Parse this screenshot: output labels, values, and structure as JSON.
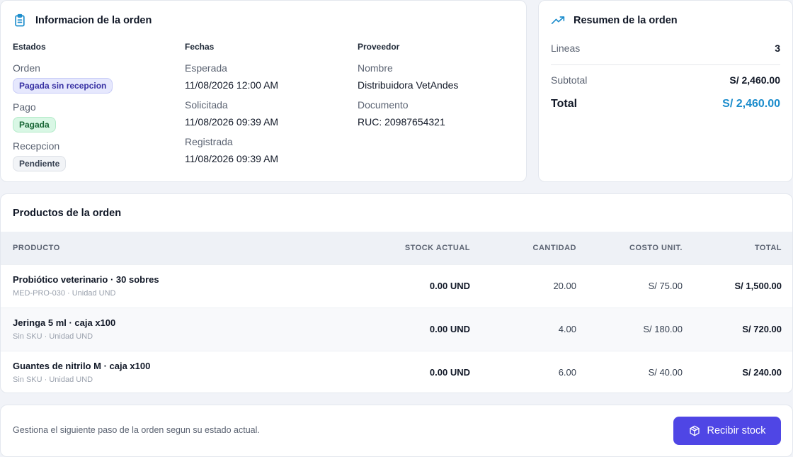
{
  "info": {
    "title": "Informacion de la orden",
    "icon": "clipboard-icon",
    "estados": {
      "heading": "Estados",
      "orden_label": "Orden",
      "orden_badge": "Pagada sin recepcion",
      "pago_label": "Pago",
      "pago_badge": "Pagada",
      "recepcion_label": "Recepcion",
      "recepcion_badge": "Pendiente"
    },
    "fechas": {
      "heading": "Fechas",
      "esperada_label": "Esperada",
      "esperada_value": "11/08/2026 12:00 AM",
      "solicitada_label": "Solicitada",
      "solicitada_value": "11/08/2026 09:39 AM",
      "registrada_label": "Registrada",
      "registrada_value": "11/08/2026 09:39 AM"
    },
    "proveedor": {
      "heading": "Proveedor",
      "nombre_label": "Nombre",
      "nombre_value": "Distribuidora VetAndes",
      "documento_label": "Documento",
      "documento_value": "RUC: 20987654321"
    }
  },
  "summary": {
    "title": "Resumen de la orden",
    "icon": "trending-up-icon",
    "lineas_label": "Lineas",
    "lineas_value": "3",
    "subtotal_label": "Subtotal",
    "subtotal_value": "S/ 2,460.00",
    "total_label": "Total",
    "total_value": "S/ 2,460.00"
  },
  "products": {
    "title": "Productos de la orden",
    "columns": [
      "PRODUCTO",
      "STOCK ACTUAL",
      "CANTIDAD",
      "COSTO UNIT.",
      "TOTAL"
    ],
    "rows": [
      {
        "name": "Probiótico veterinario · 30 sobres",
        "sub": "MED-PRO-030 · Unidad UND",
        "stock": "0.00 UND",
        "qty": "20.00",
        "unit_cost": "S/ 75.00",
        "total": "S/ 1,500.00"
      },
      {
        "name": "Jeringa 5 ml · caja x100",
        "sub": "Sin SKU · Unidad UND",
        "stock": "0.00 UND",
        "qty": "4.00",
        "unit_cost": "S/ 180.00",
        "total": "S/ 720.00"
      },
      {
        "name": "Guantes de nitrilo M · caja x100",
        "sub": "Sin SKU · Unidad UND",
        "stock": "0.00 UND",
        "qty": "6.00",
        "unit_cost": "S/ 40.00",
        "total": "S/ 240.00"
      }
    ]
  },
  "footer": {
    "text": "Gestiona el siguiente paso de la orden segun su estado actual.",
    "button_label": "Recibir stock",
    "button_icon": "package-icon"
  },
  "colors": {
    "accent": "#4f46e5",
    "total_blue": "#1b8ccc",
    "icon_blue": "#1b8ccc"
  }
}
